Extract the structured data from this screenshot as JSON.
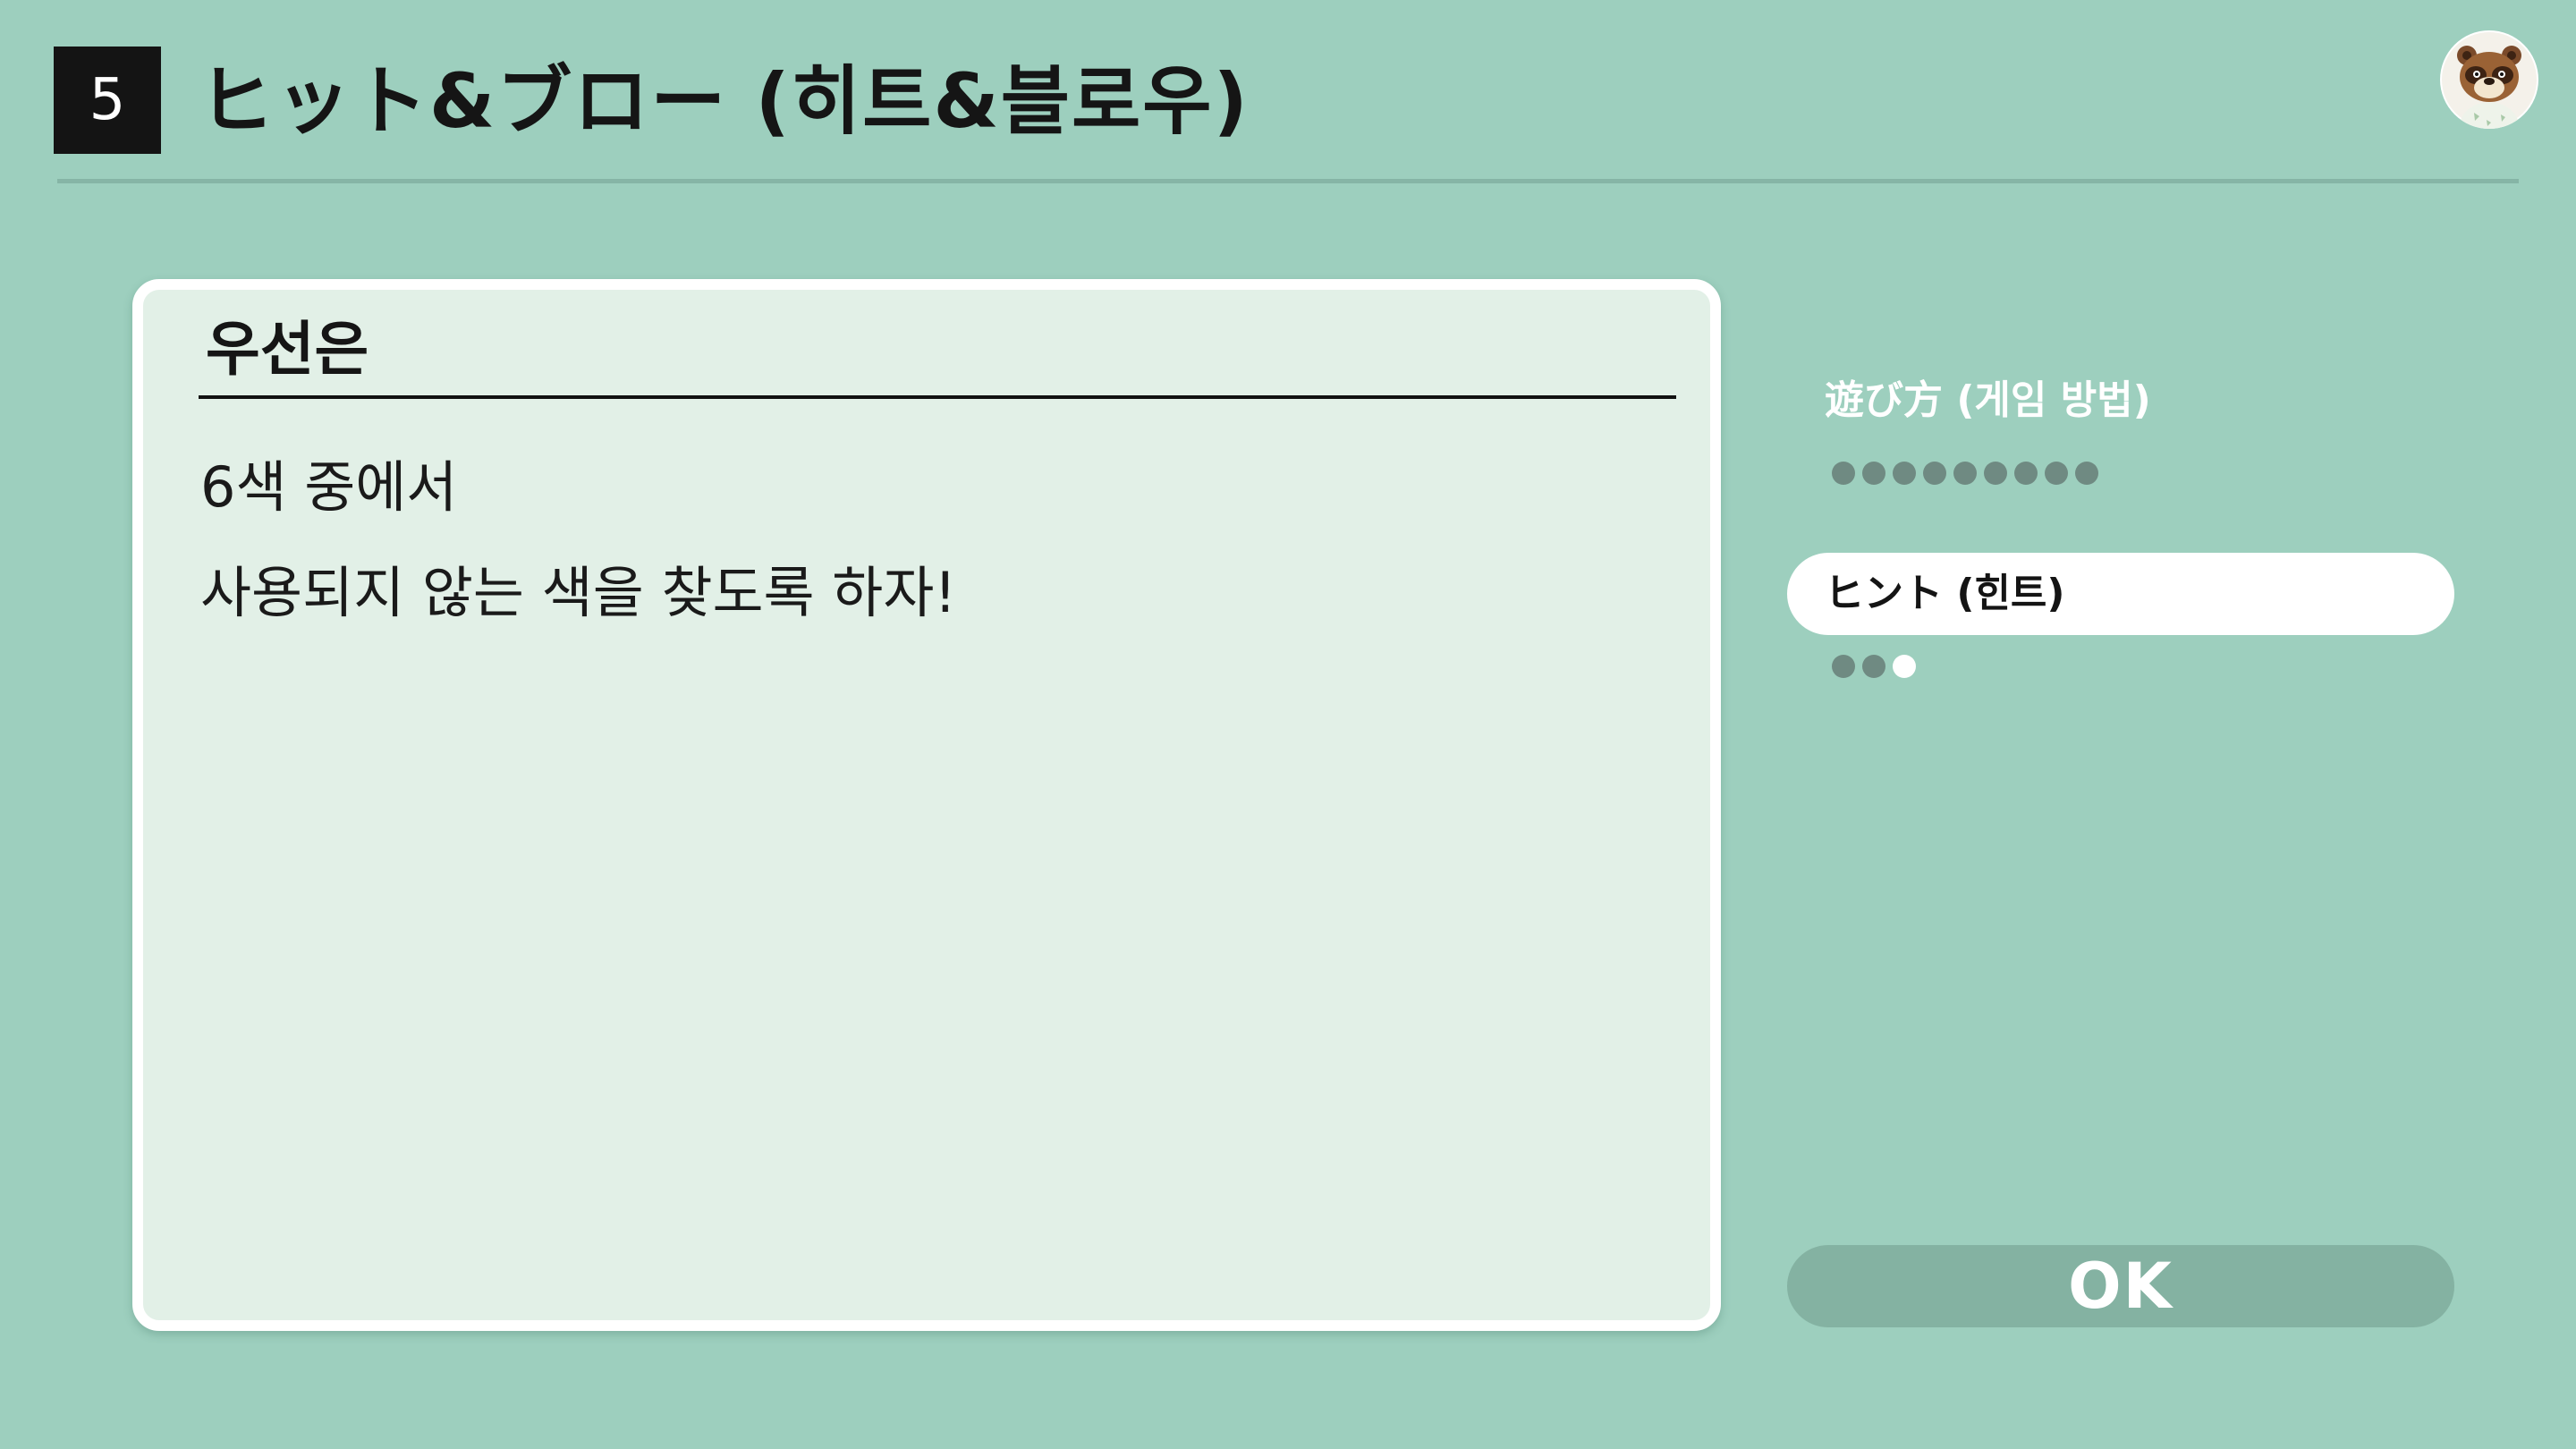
{
  "header": {
    "chapter_number": "5",
    "title": "ヒット&ブロー (히트&블로우)"
  },
  "card": {
    "heading": "우선은",
    "lines": [
      "6색 중에서",
      "사용되지 않는 색을 찾도록 하자!"
    ]
  },
  "sidebar": {
    "items": [
      {
        "label": "遊び方 (게임 방법)",
        "pages": 9,
        "current_page": null
      },
      {
        "label": "ヒント (힌트)",
        "pages": 3,
        "current_page": 3,
        "selected": true
      }
    ]
  },
  "ok_button": {
    "label": "OK"
  },
  "icons": {
    "avatar": "tom-nook-avatar-icon"
  },
  "colors": {
    "background": "#9dcfbe",
    "card_background": "#e2f0e7",
    "ok_button": "#84b2a2",
    "dot_inactive": "#6f8a82",
    "dot_active": "#ffffff"
  }
}
